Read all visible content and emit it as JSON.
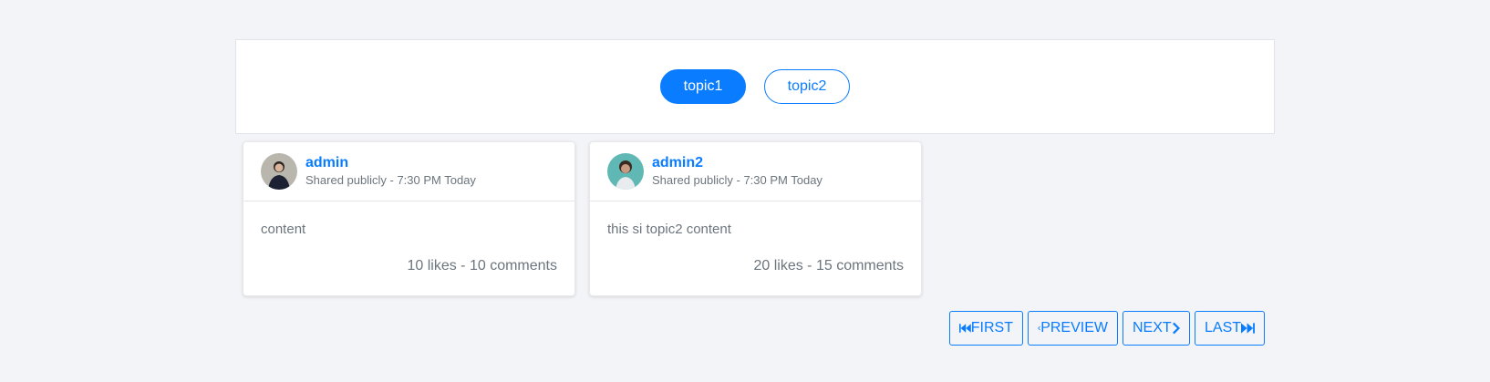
{
  "topics": [
    {
      "label": "topic1",
      "active": true
    },
    {
      "label": "topic2",
      "active": false
    }
  ],
  "posts": [
    {
      "author": "admin",
      "meta": "Shared publicly - 7:30 PM Today",
      "content": "content",
      "stats": "10 likes - 10 comments"
    },
    {
      "author": "admin2",
      "meta": "Shared publicly - 7:30 PM Today",
      "content": "this si topic2 content",
      "stats": "20 likes - 15 comments"
    }
  ],
  "pagination": {
    "first": "FIRST",
    "preview": "PREVIEW",
    "next": "NEXT",
    "last": "LAST"
  },
  "colors": {
    "accent": "#0a7cff",
    "background": "#f3f4f7",
    "muted": "#6c757d"
  }
}
